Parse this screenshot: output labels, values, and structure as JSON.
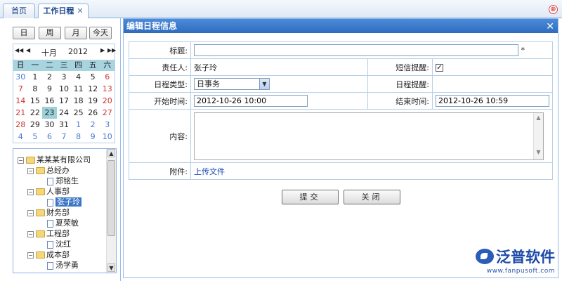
{
  "tabs": [
    {
      "label": "首页"
    },
    {
      "label": "工作日程",
      "close": "✕"
    }
  ],
  "window_close": "⊗",
  "nav_buttons": [
    "日",
    "周",
    "月",
    "今天"
  ],
  "calendar": {
    "prev_year": "◀◀",
    "prev_month": "◀",
    "month": "十月",
    "year": "2012",
    "next_month": "▶",
    "next_year": "▶▶",
    "weekdays": [
      "日",
      "一",
      "二",
      "三",
      "四",
      "五",
      "六"
    ],
    "weeks": [
      [
        "30",
        "1",
        "2",
        "3",
        "4",
        "5",
        "6"
      ],
      [
        "7",
        "8",
        "9",
        "10",
        "11",
        "12",
        "13"
      ],
      [
        "14",
        "15",
        "16",
        "17",
        "18",
        "19",
        "20"
      ],
      [
        "21",
        "22",
        "23",
        "24",
        "25",
        "26",
        "27"
      ],
      [
        "28",
        "29",
        "30",
        "31",
        "1",
        "2",
        "3"
      ],
      [
        "4",
        "5",
        "6",
        "7",
        "8",
        "9",
        "10"
      ]
    ],
    "selected_day": "23"
  },
  "tree": {
    "root": "某某某有限公司",
    "depts": [
      {
        "name": "总经办",
        "people": [
          "郑铭生"
        ]
      },
      {
        "name": "人事部",
        "people": [
          "张子玲"
        ]
      },
      {
        "name": "财务部",
        "people": [
          "夏荣敏"
        ]
      },
      {
        "name": "工程部",
        "people": [
          "沈红"
        ]
      },
      {
        "name": "成本部",
        "people": [
          "汤学勇"
        ]
      }
    ],
    "selected_person": "张子玲"
  },
  "dialog": {
    "title": "编辑日程信息",
    "close": "✕",
    "labels": {
      "title": "标题:",
      "owner": "责任人:",
      "sms": "短信提醒:",
      "type": "日程类型:",
      "reminder": "日程提醒:",
      "start": "开始时间:",
      "end": "结束时间:",
      "content": "内容:",
      "attach": "附件:"
    },
    "values": {
      "title": "",
      "required_mark": "*",
      "owner": "张子玲",
      "sms_checked": "✓",
      "type": "日事务",
      "start": "2012-10-26 10:00",
      "end": "2012-10-26 10:59",
      "upload_link": "上传文件"
    },
    "buttons": {
      "submit": "提交",
      "close": "关闭"
    }
  },
  "watermark": {
    "name": "泛普软件",
    "url": "www.fanpusoft.com"
  }
}
